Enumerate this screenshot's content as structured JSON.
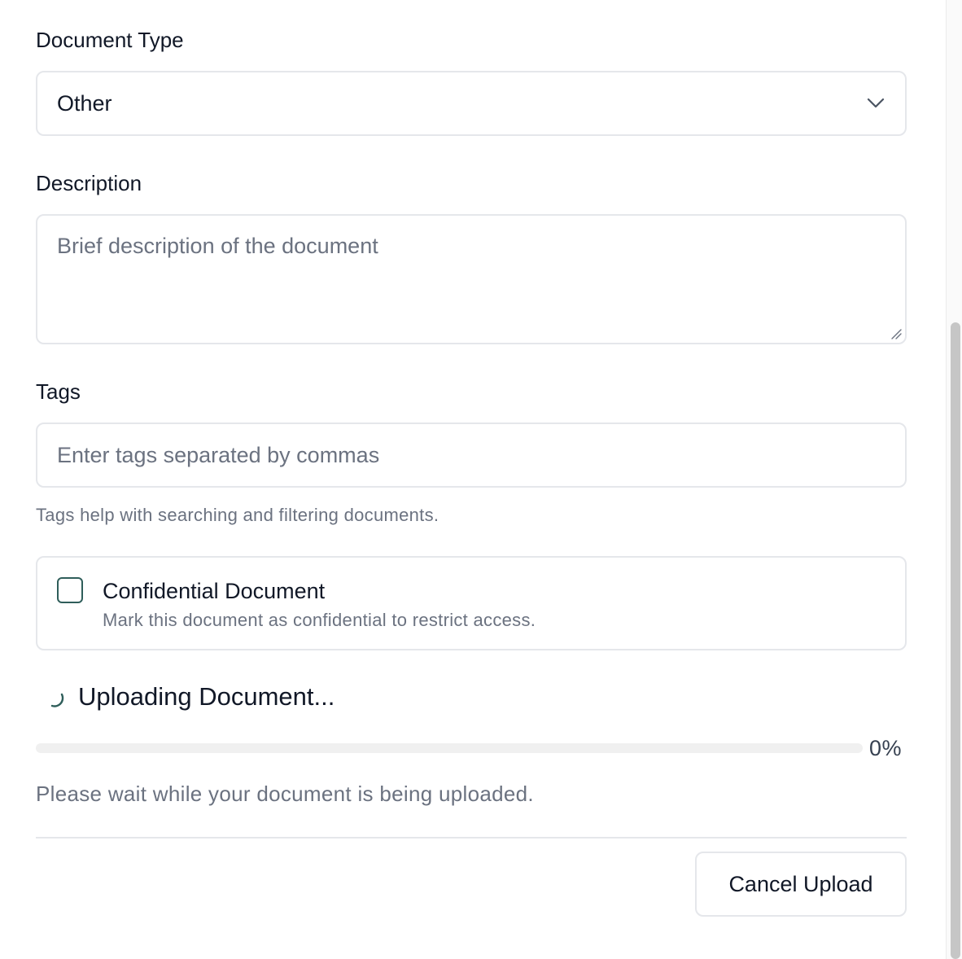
{
  "form": {
    "document_type": {
      "label": "Document Type",
      "selected": "Other"
    },
    "description": {
      "label": "Description",
      "placeholder": "Brief description of the document",
      "value": ""
    },
    "tags": {
      "label": "Tags",
      "placeholder": "Enter tags separated by commas",
      "value": "",
      "help": "Tags help with searching and filtering documents."
    },
    "confidential": {
      "checked": false,
      "title": "Confidential Document",
      "description": "Mark this document as confidential to restrict access."
    }
  },
  "upload": {
    "title": "Uploading Document...",
    "progress_fraction": 0,
    "progress_text": "0%",
    "message": "Please wait while your document is being uploaded."
  },
  "actions": {
    "cancel_label": "Cancel Upload"
  },
  "colors": {
    "accent": "#2f5e5a",
    "border": "#e5e7eb",
    "muted_text": "#6b7280"
  },
  "icons": {
    "select": "chevron-down-icon",
    "spinner": "spinner-icon",
    "resize": "resize-grip-icon"
  }
}
